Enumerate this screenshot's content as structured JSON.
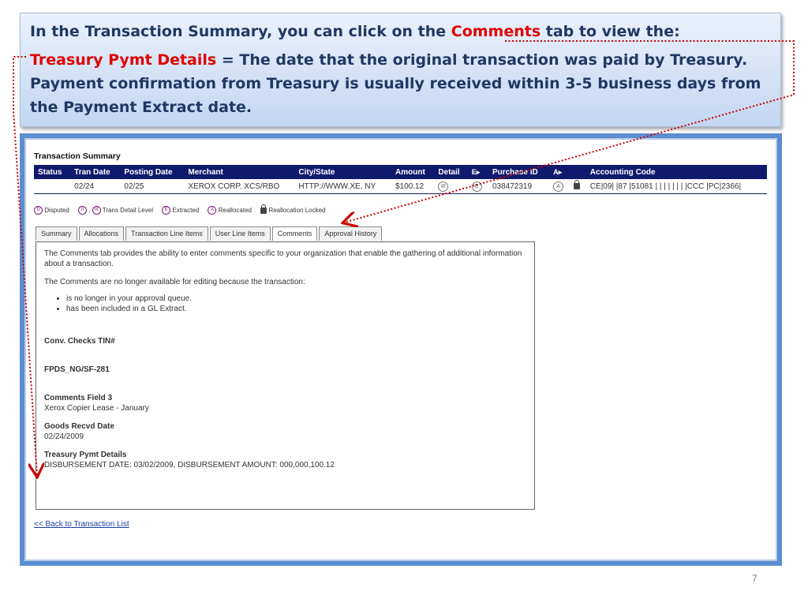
{
  "callout": {
    "line1_prefix": "In the Transaction Summary, you can click on the ",
    "line1_highlight": "Comments",
    "line1_suffix": " tab to view the:",
    "line2_highlight": "Treasury Pymt Details",
    "line2_text": " = The date that the original transaction was paid by Treasury. Payment confirmation from Treasury is usually received within 3-5 business days from the Payment Extract date."
  },
  "summary": {
    "title": "Transaction Summary",
    "columns": [
      "Status",
      "Tran Date",
      "Posting Date",
      "Merchant",
      "City/State",
      "Amount",
      "Detail",
      "",
      "Purchase ID",
      "",
      "",
      "Accounting Code"
    ],
    "row": {
      "status": "",
      "tran_date": "02/24",
      "posting_date": "02/25",
      "merchant": "XEROX CORP. XCS/RBO",
      "city_state": "HTTP://WWW.XE, NY",
      "amount": "$100.12",
      "purchase_id": "038472319",
      "accounting_code": "CE|09| |87 |51081 | | | | | | | |CCC |PC|2366|"
    }
  },
  "legend": {
    "disputed": "Disputed",
    "trans_detail": "Trans Detail Level",
    "extracted": "Extracted",
    "reallocated": "Reallocated",
    "reallocation_locked": "Reallocation Locked"
  },
  "tabs": [
    "Summary",
    "Allocations",
    "Transaction Line Items",
    "User Line Items",
    "Comments",
    "Approval History"
  ],
  "comments": {
    "intro": "The Comments tab provides the ability to enter comments specific to your organization that enable the gathering of additional information about a transaction.",
    "not_available": "The Comments are no longer available for editing because the transaction:",
    "reasons": [
      "is no longer in your approval queue.",
      "has been included in a GL Extract."
    ],
    "fields": [
      {
        "label": "Conv. Checks TIN#",
        "value": ""
      },
      {
        "label": "FPDS_NG/SF-281",
        "value": ""
      },
      {
        "label": "Comments Field 3",
        "value": "Xerox Copier Lease - January"
      },
      {
        "label": "Goods Recvd Date",
        "value": "02/24/2009"
      },
      {
        "label": "Treasury Pymt Details",
        "value": "DISBURSEMENT DATE: 03/02/2009, DISBURSEMENT AMOUNT: 000,000,100.12"
      }
    ]
  },
  "back_link": "<< Back to Transaction List",
  "page_number": "7",
  "colors": {
    "accent_red": "#e00000",
    "callout_text": "#1f3864",
    "header_navy": "#0f1a6e",
    "frame_blue": "#5b8ed0",
    "arrow_red": "#cc0000"
  }
}
